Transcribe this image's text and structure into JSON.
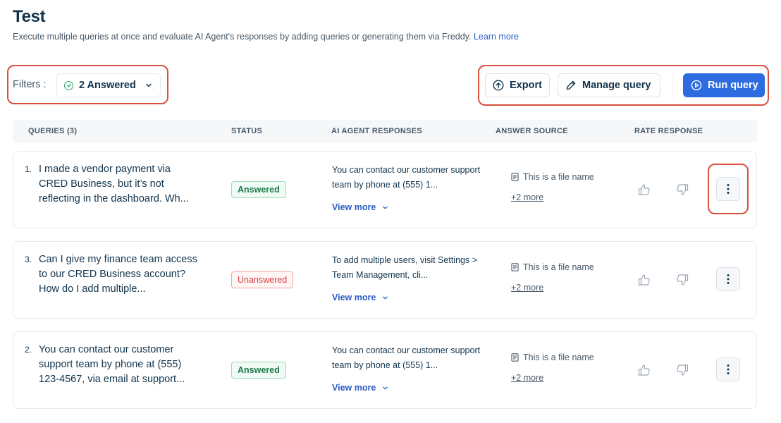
{
  "page": {
    "title": "Test",
    "description": "Execute multiple queries at once and evaluate AI Agent's responses by adding queries or generating them via Freddy.",
    "learn_more": "Learn more"
  },
  "filters": {
    "label": "Filters :",
    "chip_label": "2 Answered",
    "chip_icon": "check-circle-icon"
  },
  "toolbar": {
    "export_label": "Export",
    "manage_label": "Manage query",
    "run_label": "Run query"
  },
  "table": {
    "headers": [
      "QUERIES (3)",
      "STATUS",
      "AI AGENT RESPONSES",
      "ANSWER SOURCE",
      "RATE RESPONSE"
    ],
    "rows": [
      {
        "num": "1.",
        "query": "I made a vendor payment via CRED Business, but it’s not reflecting in the dashboard. Wh...",
        "status": "Answered",
        "response": "You can contact our customer support team by phone at (555) 1...",
        "view_more": "View more",
        "source": "This is a file name",
        "more": "+2 more"
      },
      {
        "num": "3.",
        "query": "Can I give my finance team access to our CRED Business account? How do I add multiple...",
        "status": "Unanswered",
        "response": "To add multiple users, visit Settings > Team Management, cli...",
        "view_more": "View more",
        "source": "This is a file name",
        "more": "+2 more"
      },
      {
        "num": "2.",
        "query": "You can contact our customer support team by phone at (555) 123-4567, via email at support...",
        "status": "Answered",
        "response": "You can contact our customer support team by phone at (555) 1...",
        "view_more": "View more",
        "source": "This is a file name",
        "more": "+2 more"
      }
    ]
  },
  "colors": {
    "primary": "#2c6ce0",
    "highlight": "#d9513f",
    "answered": "#1e7a4d",
    "unanswered": "#d43f3f"
  }
}
